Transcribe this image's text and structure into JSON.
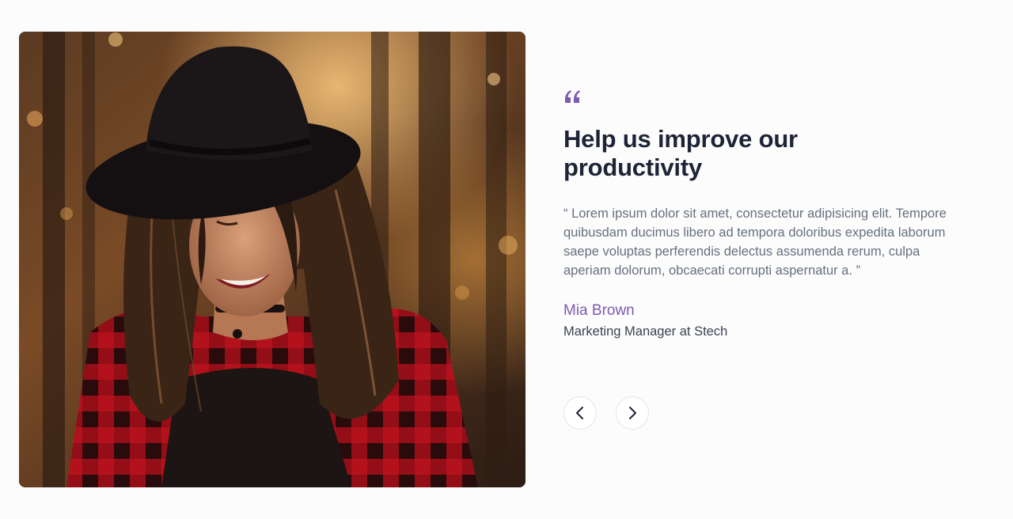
{
  "testimonial": {
    "photo_alt": "Smiling woman in a black hat and red plaid shirt in a forest",
    "headline": "Help us improve our productivity",
    "quote": "“ Lorem ipsum dolor sit amet, consectetur adipisicing elit. Tempore quibusdam ducimus libero ad tempora doloribus expedita laborum saepe voluptas perferendis delectus assumenda rerum, culpa aperiam dolorum, obcaecati corrupti aspernatur a. ”",
    "author_name": "Mia Brown",
    "author_role": "Marketing Manager at Stech"
  },
  "controls": {
    "prev_icon": "chevron-left-icon",
    "next_icon": "chevron-right-icon"
  },
  "colors": {
    "accent": "#7c5bb0",
    "heading": "#1d2436",
    "body": "#66707d",
    "background": "#fcfcfd"
  }
}
